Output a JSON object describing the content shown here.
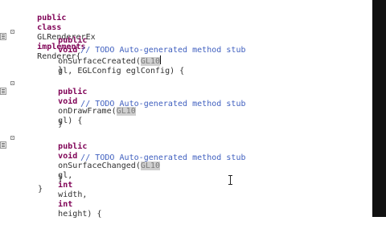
{
  "editor": {
    "lines": {
      "l1": {
        "kw1": "public",
        "kw2": "class",
        "text": "GLRendererEx",
        "kw3": "implements",
        "text2": "Renderer{"
      },
      "l2": {
        "kw1": "public",
        "kw2": "void",
        "text": "onSurfaceCreated(",
        "hl": "GL10",
        "text2": "gl, EGLConfig eglConfig) {"
      },
      "l3": {
        "comment": "// TODO Auto-generated method stub"
      },
      "l4": {
        "text": "}"
      },
      "l5": {
        "kw1": "public",
        "kw2": "void",
        "text": "onDrawFrame(",
        "hl": "GL10",
        "text2": "gl) {"
      },
      "l6": {
        "comment": "// TODO Auto-generated method stub"
      },
      "l7": {
        "text": "}"
      },
      "l8": {
        "kw1": "public",
        "kw2": "void",
        "text": "onSurfaceChanged(",
        "hl": "GL10",
        "text2": "gl,",
        "kw3": "int",
        "text3": "width,",
        "kw4": "int",
        "text4": "height) {"
      },
      "l9": {
        "comment": "// TODO Auto-generated method stub"
      },
      "l10": {
        "text": "}"
      },
      "l11": {
        "text": "}"
      }
    }
  },
  "icons": {
    "fold": "collapse-icon",
    "task": "task-marker-icon",
    "cursor": "text-cursor-icon"
  },
  "colors": {
    "keyword": "#7f0055",
    "comment": "#3f5fbf",
    "highlight": "#cfcfcf"
  }
}
